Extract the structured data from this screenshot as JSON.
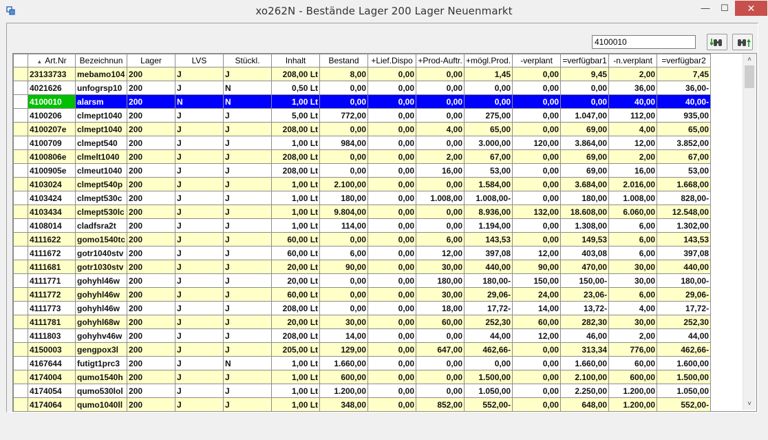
{
  "window": {
    "title": "xo262N - Bestände Lager 200 Lager Neuenmarkt",
    "minimize": "—",
    "maximize": "☐",
    "close": "✕"
  },
  "toolbar": {
    "search_value": "4100010",
    "search_down_icon": "binoculars-down-icon",
    "search_up_icon": "binoculars-up-icon"
  },
  "table": {
    "columns": [
      "",
      "Art.Nr",
      "Bezeichnun",
      "Lager",
      "LVS",
      "Stückl.",
      "Inhalt",
      "Bestand",
      "+Lief.Dispo",
      "+Prod-Auftr.",
      "+mögl.Prod.",
      "-verplant",
      "=verfügbar1",
      "-n.verplant",
      "=verfügbar2"
    ],
    "selected_index": 2,
    "rows": [
      [
        "",
        "23133733",
        "mebamo104",
        "200",
        "J",
        "J",
        "208,00 Lt",
        "8,00",
        "0,00",
        "0,00",
        "1,45",
        "0,00",
        "9,45",
        "2,00",
        "7,45"
      ],
      [
        "",
        "4021626",
        "unfogrsp10",
        "200",
        "J",
        "N",
        "0,50 Lt",
        "0,00",
        "0,00",
        "0,00",
        "0,00",
        "0,00",
        "0,00",
        "36,00",
        "36,00-"
      ],
      [
        "",
        "4100010",
        "alarsm",
        "200",
        "N",
        "N",
        "1,00 Lt",
        "0,00",
        "0,00",
        "0,00",
        "0,00",
        "0,00",
        "0,00",
        "40,00",
        "40,00-"
      ],
      [
        "",
        "4100206",
        "clmept1040",
        "200",
        "J",
        "J",
        "5,00 Lt",
        "772,00",
        "0,00",
        "0,00",
        "275,00",
        "0,00",
        "1.047,00",
        "112,00",
        "935,00"
      ],
      [
        "",
        "4100207e",
        "clmept1040",
        "200",
        "J",
        "J",
        "208,00 Lt",
        "0,00",
        "0,00",
        "4,00",
        "65,00",
        "0,00",
        "69,00",
        "4,00",
        "65,00"
      ],
      [
        "",
        "4100709",
        "clmept540",
        "200",
        "J",
        "J",
        "1,00 Lt",
        "984,00",
        "0,00",
        "0,00",
        "3.000,00",
        "120,00",
        "3.864,00",
        "12,00",
        "3.852,00"
      ],
      [
        "",
        "4100806e",
        "clmelt1040",
        "200",
        "J",
        "J",
        "208,00 Lt",
        "0,00",
        "0,00",
        "2,00",
        "67,00",
        "0,00",
        "69,00",
        "2,00",
        "67,00"
      ],
      [
        "",
        "4100905e",
        "clmeut1040",
        "200",
        "J",
        "J",
        "208,00 Lt",
        "0,00",
        "0,00",
        "16,00",
        "53,00",
        "0,00",
        "69,00",
        "16,00",
        "53,00"
      ],
      [
        "",
        "4103024",
        "clmept540p",
        "200",
        "J",
        "J",
        "1,00 Lt",
        "2.100,00",
        "0,00",
        "0,00",
        "1.584,00",
        "0,00",
        "3.684,00",
        "2.016,00",
        "1.668,00"
      ],
      [
        "",
        "4103424",
        "clmept530c",
        "200",
        "J",
        "J",
        "1,00 Lt",
        "180,00",
        "0,00",
        "1.008,00",
        "1.008,00-",
        "0,00",
        "180,00",
        "1.008,00",
        "828,00-"
      ],
      [
        "",
        "4103434",
        "clmept530lc",
        "200",
        "J",
        "J",
        "1,00 Lt",
        "9.804,00",
        "0,00",
        "0,00",
        "8.936,00",
        "132,00",
        "18.608,00",
        "6.060,00",
        "12.548,00"
      ],
      [
        "",
        "4108014",
        "cladfsra2t",
        "200",
        "J",
        "J",
        "1,00 Lt",
        "114,00",
        "0,00",
        "0,00",
        "1.194,00",
        "0,00",
        "1.308,00",
        "6,00",
        "1.302,00"
      ],
      [
        "",
        "4111622",
        "gomo1540tc",
        "200",
        "J",
        "J",
        "60,00 Lt",
        "0,00",
        "0,00",
        "6,00",
        "143,53",
        "0,00",
        "149,53",
        "6,00",
        "143,53"
      ],
      [
        "",
        "4111672",
        "gotr1040stv",
        "200",
        "J",
        "J",
        "60,00 Lt",
        "6,00",
        "0,00",
        "12,00",
        "397,08",
        "12,00",
        "403,08",
        "6,00",
        "397,08"
      ],
      [
        "",
        "4111681",
        "gotr1030stv",
        "200",
        "J",
        "J",
        "20,00 Lt",
        "90,00",
        "0,00",
        "30,00",
        "440,00",
        "90,00",
        "470,00",
        "30,00",
        "440,00"
      ],
      [
        "",
        "4111771",
        "gohyhl46w",
        "200",
        "J",
        "J",
        "20,00 Lt",
        "0,00",
        "0,00",
        "180,00",
        "180,00-",
        "150,00",
        "150,00-",
        "30,00",
        "180,00-"
      ],
      [
        "",
        "4111772",
        "gohyhl46w",
        "200",
        "J",
        "J",
        "60,00 Lt",
        "0,00",
        "0,00",
        "30,00",
        "29,06-",
        "24,00",
        "23,06-",
        "6,00",
        "29,06-"
      ],
      [
        "",
        "4111773",
        "gohyhl46w",
        "200",
        "J",
        "J",
        "208,00 Lt",
        "0,00",
        "0,00",
        "18,00",
        "17,72-",
        "14,00",
        "13,72-",
        "4,00",
        "17,72-"
      ],
      [
        "",
        "4111781",
        "gohyhl68w",
        "200",
        "J",
        "J",
        "20,00 Lt",
        "30,00",
        "0,00",
        "60,00",
        "252,30",
        "60,00",
        "282,30",
        "30,00",
        "252,30"
      ],
      [
        "",
        "4111803",
        "gohyhv46w",
        "200",
        "J",
        "J",
        "208,00 Lt",
        "14,00",
        "0,00",
        "0,00",
        "44,00",
        "12,00",
        "46,00",
        "2,00",
        "44,00"
      ],
      [
        "",
        "4150003",
        "gengpox3l",
        "200",
        "J",
        "J",
        "205,00 Lt",
        "129,00",
        "0,00",
        "647,00",
        "462,66-",
        "0,00",
        "313,34",
        "776,00",
        "462,66-"
      ],
      [
        "",
        "4167644",
        "futigt1prc3",
        "200",
        "J",
        "N",
        "1,00 Lt",
        "1.660,00",
        "0,00",
        "0,00",
        "0,00",
        "0,00",
        "1.660,00",
        "60,00",
        "1.600,00"
      ],
      [
        "",
        "4174004",
        "qumo1540h",
        "200",
        "J",
        "J",
        "1,00 Lt",
        "600,00",
        "0,00",
        "0,00",
        "1.500,00",
        "0,00",
        "2.100,00",
        "600,00",
        "1.500,00"
      ],
      [
        "",
        "4174054",
        "qumo530lol",
        "200",
        "J",
        "J",
        "1,00 Lt",
        "1.200,00",
        "0,00",
        "0,00",
        "1.050,00",
        "0,00",
        "2.250,00",
        "1.200,00",
        "1.050,00"
      ],
      [
        "",
        "4174064",
        "qumo1040ll",
        "200",
        "J",
        "J",
        "1,00 Lt",
        "348,00",
        "0,00",
        "852,00",
        "552,00-",
        "0,00",
        "648,00",
        "1.200,00",
        "552,00-"
      ]
    ]
  },
  "scrollbar": {
    "up": "˄",
    "down": "˅"
  }
}
